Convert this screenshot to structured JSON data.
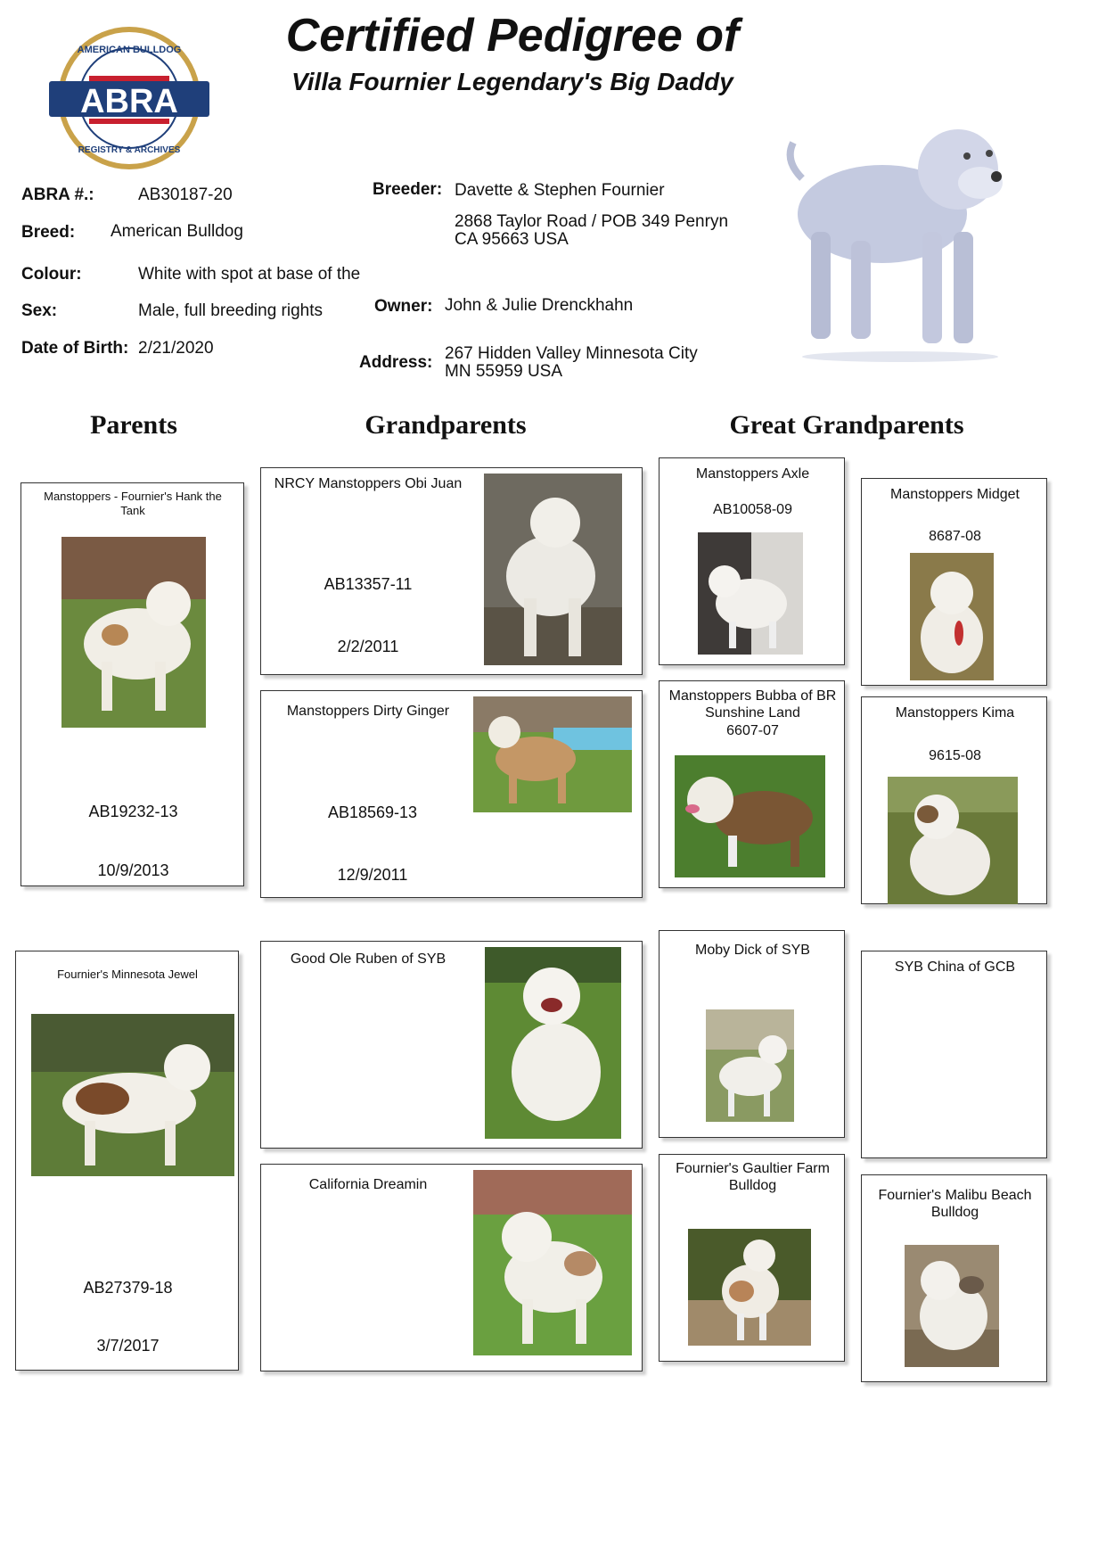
{
  "header": {
    "title": "Certified Pedigree of",
    "dog_name": "Villa Fournier Legendary's Big Daddy"
  },
  "logo": {
    "top_text": "AMERICAN BULLDOG",
    "main_text": "ABRA",
    "bottom_text": "REGISTRY & ARCHIVES"
  },
  "details": {
    "abra_label": "ABRA #.:",
    "abra_value": "AB30187-20",
    "breed_label": "Breed:",
    "breed_value": "American Bulldog",
    "colour_label": "Colour:",
    "colour_value": "White with spot at base of the tail",
    "sex_label": "Sex:",
    "sex_value": "Male, full breeding rights",
    "dob_label": "Date of Birth:",
    "dob_value": "2/21/2020",
    "breeder_label": "Breeder:",
    "breeder_value": "Davette & Stephen Fournier",
    "breeder_addr1": "2868 Taylor Road / POB 349 Penryn",
    "breeder_addr2": "CA 95663 USA",
    "owner_label": "Owner:",
    "owner_value": "John & Julie Drenckhahn",
    "address_label": "Address:",
    "owner_addr1": "267 Hidden Valley Minnesota City",
    "owner_addr2": "MN 55959 USA"
  },
  "columns": {
    "parents": "Parents",
    "grandparents": "Grandparents",
    "great_grandparents": "Great Grandparents"
  },
  "parents": [
    {
      "name": "Manstoppers - Fournier's Hank the Tank",
      "reg": "AB19232-13",
      "date": "10/9/2013"
    },
    {
      "name": "Fournier's Minnesota Jewel",
      "reg": "AB27379-18",
      "date": "3/7/2017"
    }
  ],
  "grandparents": [
    {
      "name": "NRCY Manstoppers Obi Juan",
      "reg": "AB13357-11",
      "date": "2/2/2011"
    },
    {
      "name": "Manstoppers Dirty Ginger",
      "reg": "AB18569-13",
      "date": "12/9/2011"
    },
    {
      "name": "Good Ole Ruben of SYB"
    },
    {
      "name": "California Dreamin"
    }
  ],
  "great_grandparents": [
    {
      "name": "Manstoppers Axle",
      "reg": "AB10058-09"
    },
    {
      "name": "Manstoppers Midget",
      "reg": "8687-08"
    },
    {
      "name": "Manstoppers Bubba of BR Sunshine Land",
      "reg": "6607-07"
    },
    {
      "name": "Manstoppers Kima",
      "reg": "9615-08"
    },
    {
      "name": "Moby Dick of SYB"
    },
    {
      "name": "SYB China of GCB"
    },
    {
      "name": "Fournier's Gaultier Farm Bulldog"
    },
    {
      "name": "Fournier's Malibu Beach Bulldog"
    }
  ],
  "colors": {
    "logo_blue": "#1f3f7a",
    "logo_red": "#c8202f",
    "logo_gold": "#c9a24a"
  }
}
